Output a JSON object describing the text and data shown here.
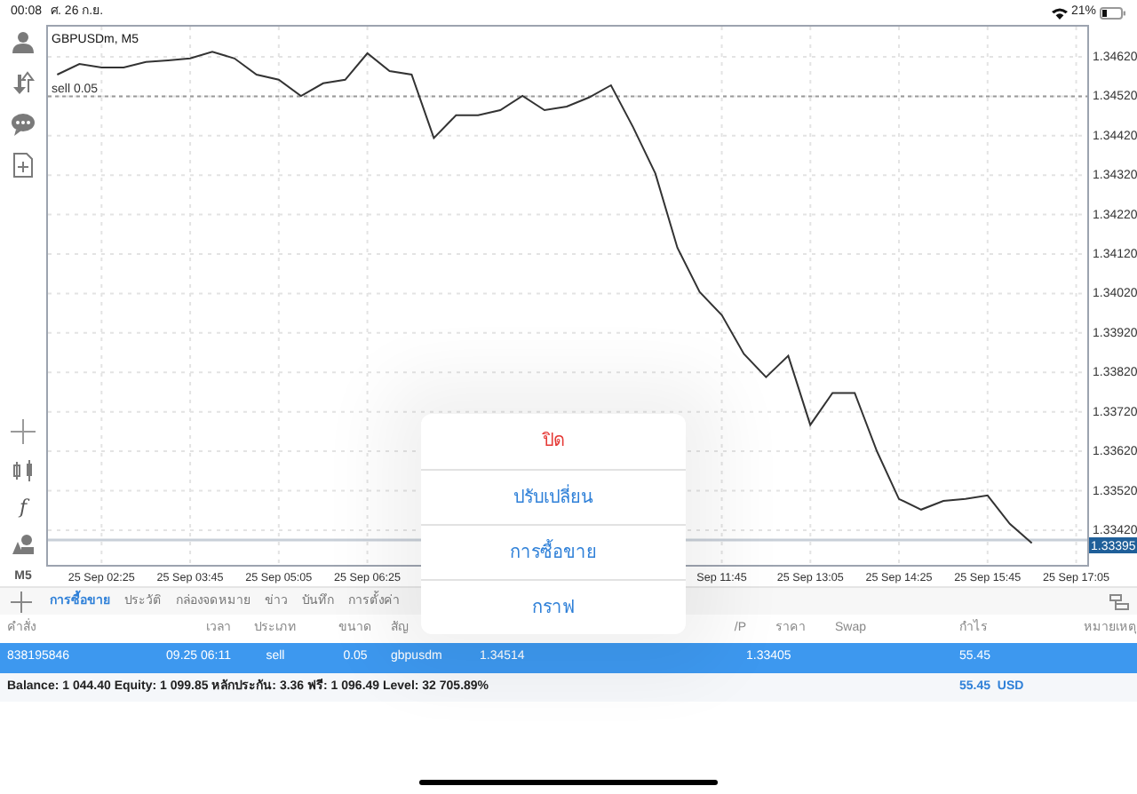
{
  "status_bar": {
    "time": "00:08",
    "date": "ศ. 26 ก.ย.",
    "battery": "21%"
  },
  "left_toolbar": {
    "function_key": "f",
    "timeframe": "M5"
  },
  "chart": {
    "chart_data": {
      "type": "line",
      "title": "GBPUSDm, M5",
      "grid": true,
      "ref_lines": [
        {
          "axis": "y",
          "value": 1.3452,
          "label": "sell 0.05"
        },
        {
          "axis": "y",
          "value": 1.33395,
          "label": "1.33395"
        }
      ],
      "categories": [
        null,
        null,
        "25 Sep 02:25",
        null,
        null,
        null,
        "25 Sep 03:45",
        null,
        null,
        null,
        "25 Sep 05:05",
        null,
        null,
        null,
        "25 Sep 06:25",
        null,
        null,
        null,
        null,
        null,
        null,
        null,
        null,
        null,
        null,
        null,
        null,
        null,
        null,
        null,
        "Sep 11:45",
        null,
        null,
        null,
        "25 Sep 13:05",
        null,
        null,
        null,
        "25 Sep 14:25",
        null,
        null,
        null,
        "25 Sep 15:45",
        null,
        null,
        null,
        "25 Sep 17:05"
      ],
      "series": [
        {
          "color": "#333333",
          "values": [
            1.34575,
            1.34602,
            1.34593,
            1.34593,
            1.34607,
            1.34611,
            1.34616,
            1.34633,
            1.34616,
            1.34575,
            1.34562,
            1.34521,
            1.34553,
            1.34562,
            1.34629,
            1.34584,
            1.34575,
            1.34414,
            1.34472,
            1.34472,
            1.34485,
            1.34521,
            1.34485,
            1.34494,
            1.34517,
            1.34548,
            1.34441,
            1.34324,
            1.34136,
            1.34024,
            1.33965,
            1.33867,
            1.33808,
            1.33862,
            1.33687,
            1.33768,
            1.33768,
            1.3362,
            1.33499,
            1.33472,
            1.33494,
            1.33499,
            1.33508,
            1.33436,
            1.33387,
            null,
            null
          ]
        }
      ],
      "ylim": [
        1.33332,
        1.34701
      ],
      "yticks": [
        {
          "value": 1.3462,
          "label": "1.34620"
        },
        {
          "value": 1.3452,
          "label": "1.34520"
        },
        {
          "value": 1.3442,
          "label": "1.34420"
        },
        {
          "value": 1.3432,
          "label": "1.34320"
        },
        {
          "value": 1.3422,
          "label": "1.34220"
        },
        {
          "value": 1.3412,
          "label": "1.34120"
        },
        {
          "value": 1.3402,
          "label": "1.34020"
        },
        {
          "value": 1.3392,
          "label": "1.33920"
        },
        {
          "value": 1.3382,
          "label": "1.33820"
        },
        {
          "value": 1.3372,
          "label": "1.33720"
        },
        {
          "value": 1.3362,
          "label": "1.33620"
        },
        {
          "value": 1.3352,
          "label": "1.33520"
        },
        {
          "value": 1.3342,
          "label": "1.33420"
        }
      ]
    }
  },
  "bottom_tabs": [
    {
      "label": "การซื้อขาย",
      "selected": true
    },
    {
      "label": "ประวัติ",
      "selected": false
    },
    {
      "label": "กล่องจดหมาย",
      "selected": false
    },
    {
      "label": "ข่าว",
      "selected": false
    },
    {
      "label": "บันทึก",
      "selected": false
    },
    {
      "label": "การตั้งค่า",
      "selected": false
    }
  ],
  "table": {
    "columns": [
      "คำสั่ง",
      "เวลา",
      "ประเภท",
      "ขนาด",
      "สัญ",
      null,
      null,
      "/P",
      "ราคา",
      "Swap",
      "กำไร",
      "หมายเหตุ"
    ],
    "rows": [
      {
        "selected": true,
        "cells": [
          "838195846",
          "09.25 06:11",
          "sell",
          "0.05",
          "gbpusdm",
          "1.34514",
          "",
          "",
          "1.33405",
          "",
          "55.45",
          ""
        ]
      }
    ]
  },
  "summary": {
    "text": "Balance: 1 044.40 Equity: 1 099.85 หลักประกัน: 3.36 ฟรี: 1 096.49 Level: 32 705.89%",
    "profit": "55.45  USD"
  },
  "action_sheet": [
    {
      "kind": "destructive",
      "label": "ปิด"
    },
    {
      "kind": "default",
      "label": "ปรับเปลี่ยน"
    },
    {
      "kind": "default",
      "label": "การซื้อขาย"
    },
    {
      "kind": "default",
      "label": "กราฟ"
    }
  ]
}
